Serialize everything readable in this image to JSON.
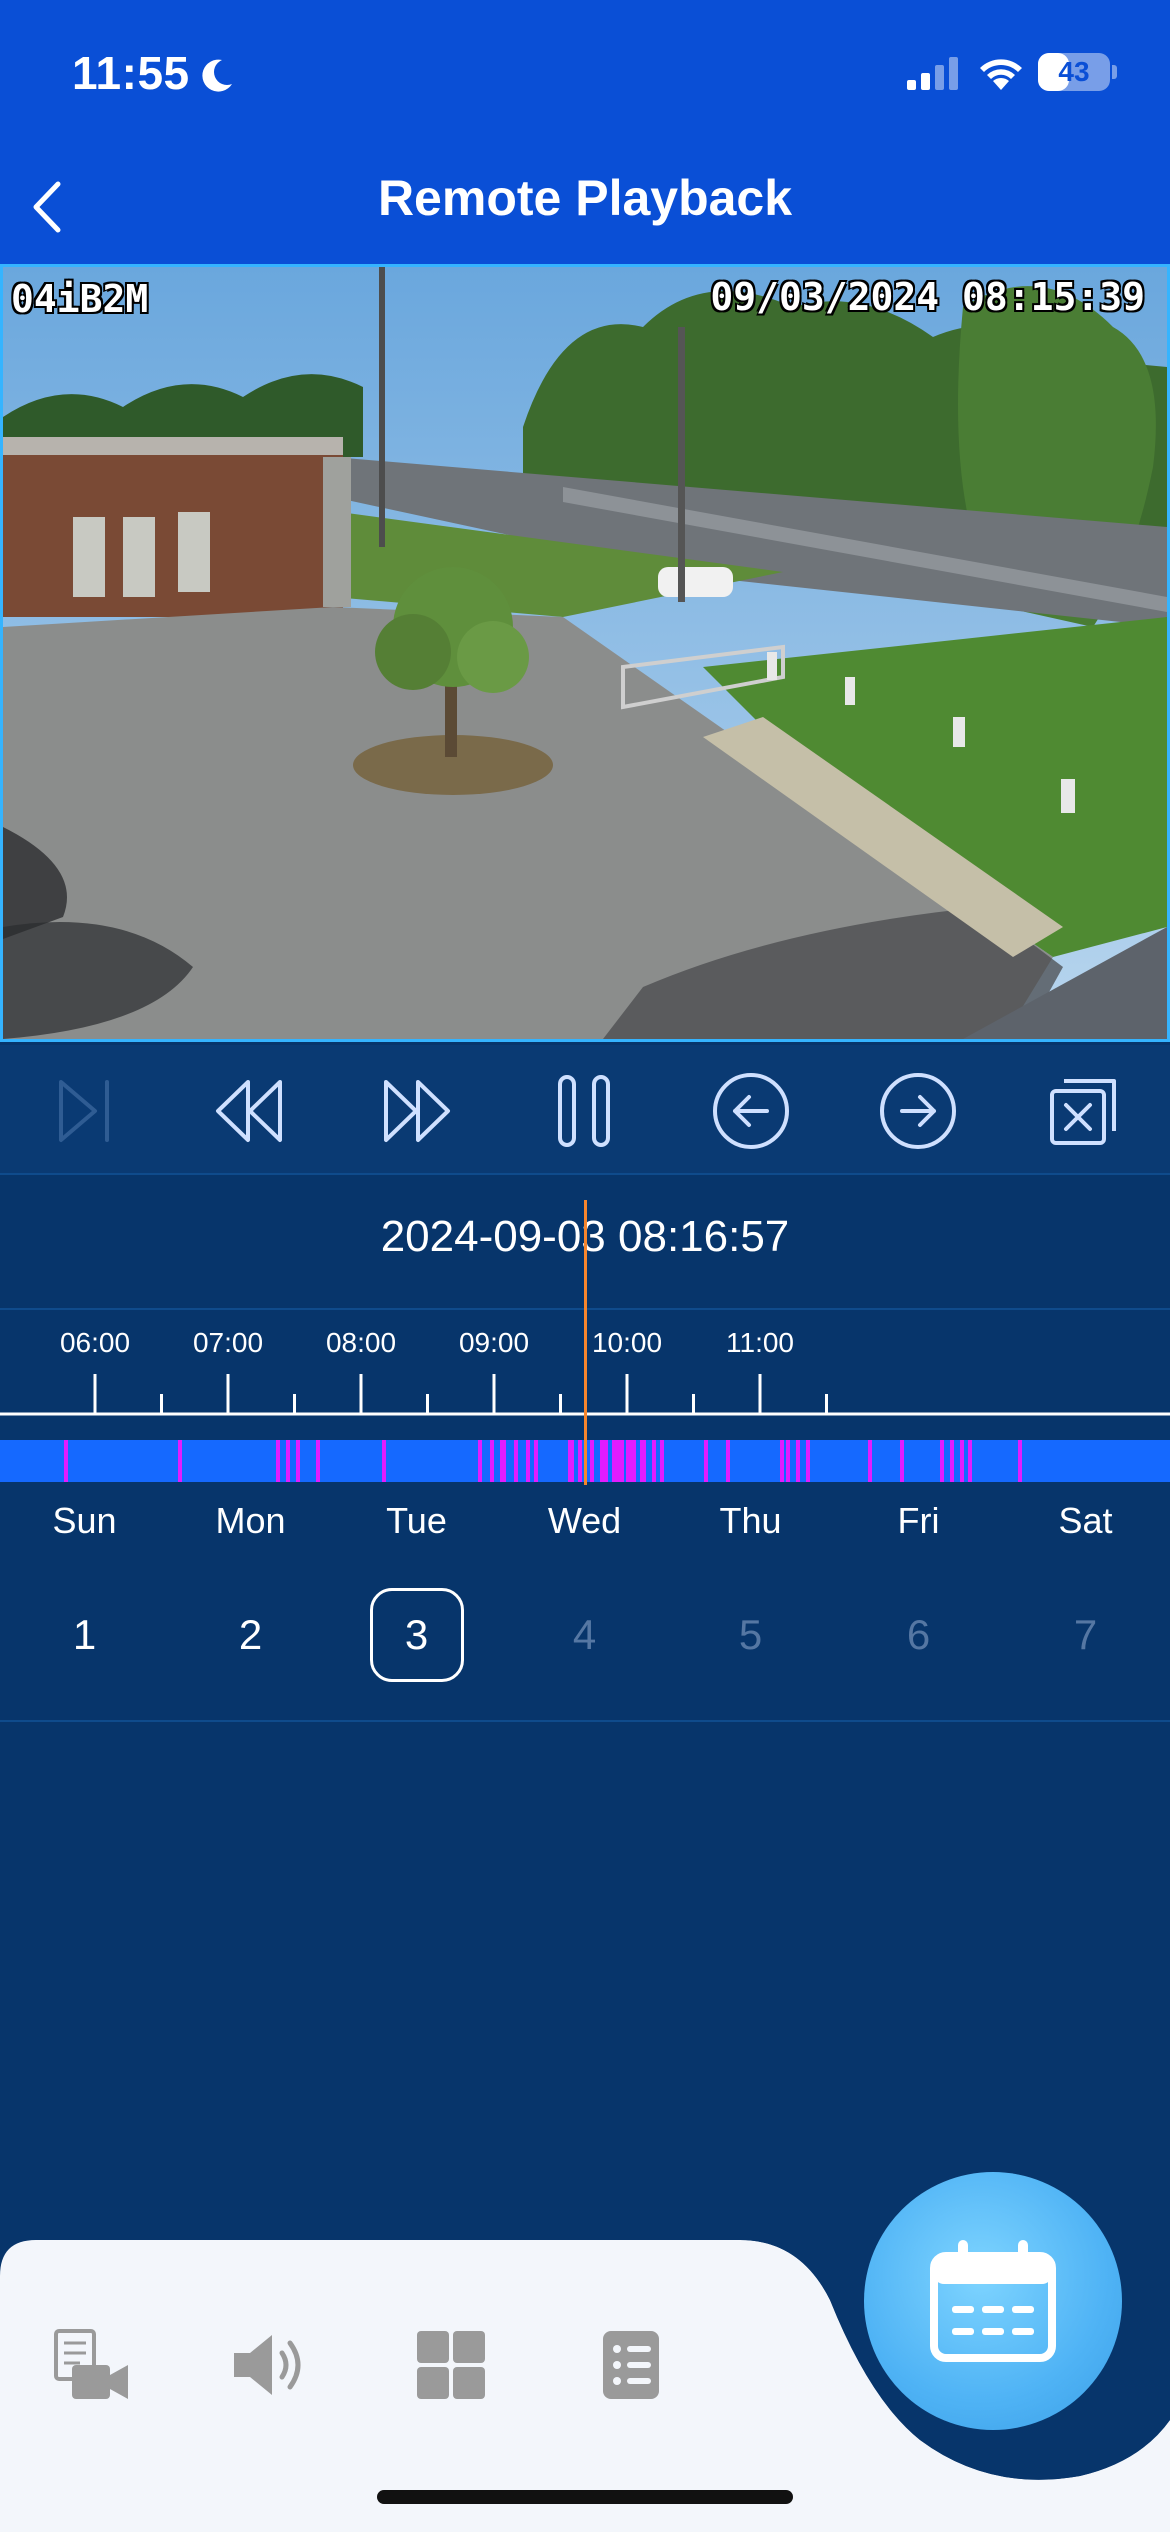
{
  "status_bar": {
    "time": "11:55",
    "battery_level": "43",
    "battery_fraction": 0.43
  },
  "nav": {
    "title": "Remote Playback"
  },
  "video": {
    "camera_label": "04iB2M",
    "timestamp": "09/03/2024 08:15:39"
  },
  "controls": [
    {
      "name": "next-frame-button",
      "icon": "skip-forward-icon",
      "enabled": false
    },
    {
      "name": "rewind-button",
      "icon": "rewind-icon",
      "enabled": true
    },
    {
      "name": "fast-forward-button",
      "icon": "fast-forward-icon",
      "enabled": true
    },
    {
      "name": "pause-button",
      "icon": "pause-icon",
      "enabled": true
    },
    {
      "name": "previous-button",
      "icon": "arrow-left-circle-icon",
      "enabled": true
    },
    {
      "name": "next-button",
      "icon": "arrow-right-circle-icon",
      "enabled": true
    },
    {
      "name": "close-window-button",
      "icon": "close-window-icon",
      "enabled": true
    }
  ],
  "timeline": {
    "current_datetime": "2024-09-03 08:16:57",
    "hour_labels": [
      "06:00",
      "07:00",
      "08:00",
      "09:00",
      "10:00",
      "11:00"
    ],
    "colors": {
      "recording": "#1569ff",
      "event": "#e21cff",
      "playhead": "#f7862d"
    }
  },
  "week": {
    "days": [
      "Sun",
      "Mon",
      "Tue",
      "Wed",
      "Thu",
      "Fri",
      "Sat"
    ],
    "dates": [
      "1",
      "2",
      "3",
      "4",
      "5",
      "6",
      "7"
    ],
    "selected_index": 2,
    "available_upto_index": 2
  },
  "tab_bar": {
    "items": [
      {
        "name": "video-record-icon"
      },
      {
        "name": "speaker-icon"
      },
      {
        "name": "grid-layout-icon"
      },
      {
        "name": "list-icon"
      }
    ],
    "fab_icon": "calendar-icon"
  },
  "colors": {
    "header": "#0a4fd6",
    "background": "#07356b",
    "accent": "#35b4ff"
  }
}
